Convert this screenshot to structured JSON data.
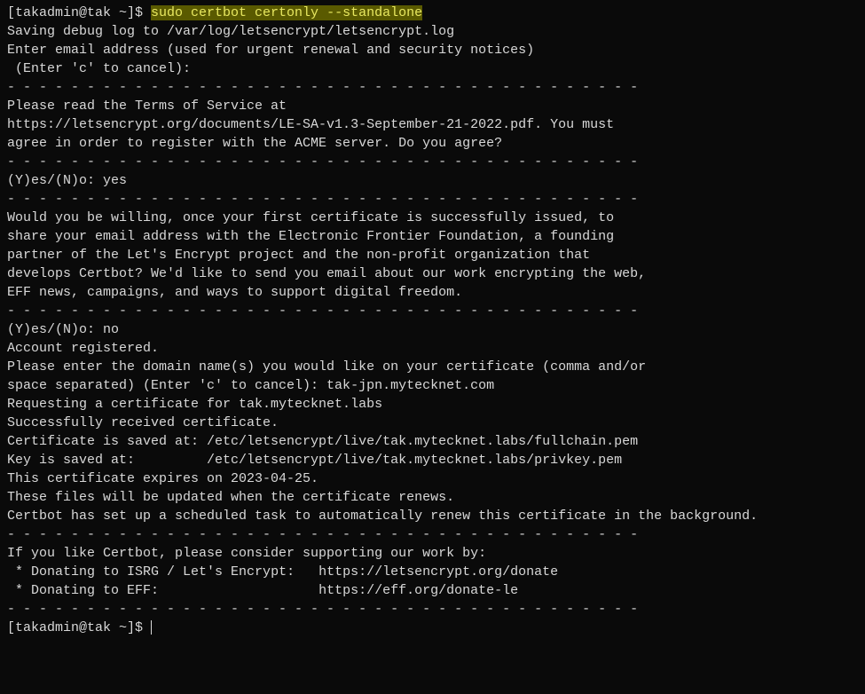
{
  "prompt1": {
    "user_host": "[takadmin@tak ~]$ ",
    "command": "sudo certbot certonly --standalone"
  },
  "lines": {
    "l01": "Saving debug log to /var/log/letsencrypt/letsencrypt.log",
    "l02": "Enter email address (used for urgent renewal and security notices)",
    "l03": " (Enter 'c' to cancel):",
    "l04": "",
    "l05": "- - - - - - - - - - - - - - - - - - - - - - - - - - - - - - - - - - - - - - - -",
    "l06": "Please read the Terms of Service at",
    "l07": "https://letsencrypt.org/documents/LE-SA-v1.3-September-21-2022.pdf. You must",
    "l08": "agree in order to register with the ACME server. Do you agree?",
    "l09": "- - - - - - - - - - - - - - - - - - - - - - - - - - - - - - - - - - - - - - - -",
    "l10": "(Y)es/(N)o: yes",
    "l11": "",
    "l12": "- - - - - - - - - - - - - - - - - - - - - - - - - - - - - - - - - - - - - - - -",
    "l13": "Would you be willing, once your first certificate is successfully issued, to",
    "l14": "share your email address with the Electronic Frontier Foundation, a founding",
    "l15": "partner of the Let's Encrypt project and the non-profit organization that",
    "l16": "develops Certbot? We'd like to send you email about our work encrypting the web,",
    "l17": "EFF news, campaigns, and ways to support digital freedom.",
    "l18": "- - - - - - - - - - - - - - - - - - - - - - - - - - - - - - - - - - - - - - - -",
    "l19": "(Y)es/(N)o: no",
    "l20": "Account registered.",
    "l21": "Please enter the domain name(s) you would like on your certificate (comma and/or",
    "l22": "space separated) (Enter 'c' to cancel): tak-jpn.mytecknet.com",
    "l23": "Requesting a certificate for tak.mytecknet.labs",
    "l24": "",
    "l25": "Successfully received certificate.",
    "l26": "Certificate is saved at: /etc/letsencrypt/live/tak.mytecknet.labs/fullchain.pem",
    "l27": "Key is saved at:         /etc/letsencrypt/live/tak.mytecknet.labs/privkey.pem",
    "l28": "This certificate expires on 2023-04-25.",
    "l29": "These files will be updated when the certificate renews.",
    "l30": "Certbot has set up a scheduled task to automatically renew this certificate in the background.",
    "l31": "",
    "l32": "- - - - - - - - - - - - - - - - - - - - - - - - - - - - - - - - - - - - - - - -",
    "l33": "If you like Certbot, please consider supporting our work by:",
    "l34": " * Donating to ISRG / Let's Encrypt:   https://letsencrypt.org/donate",
    "l35": " * Donating to EFF:                    https://eff.org/donate-le",
    "l36": "- - - - - - - - - - - - - - - - - - - - - - - - - - - - - - - - - - - - - - - -"
  },
  "prompt2": {
    "user_host": "[takadmin@tak ~]$ "
  }
}
